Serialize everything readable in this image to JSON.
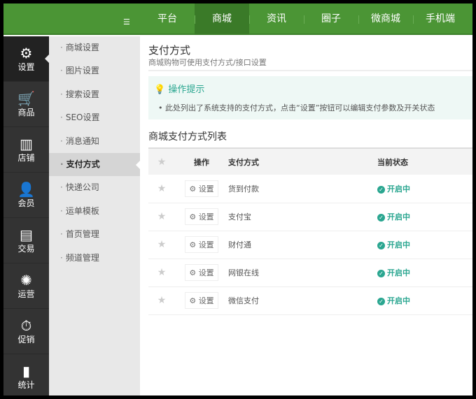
{
  "topnav": {
    "items": [
      "平台",
      "商城",
      "资讯",
      "圈子",
      "微商城",
      "手机端"
    ],
    "active": 1
  },
  "sidebar": {
    "items": [
      {
        "label": "设置",
        "icon": "gear-icon",
        "glyph": "⚙"
      },
      {
        "label": "商品",
        "icon": "basket-icon",
        "glyph": "🛒"
      },
      {
        "label": "店铺",
        "icon": "store-icon",
        "glyph": "▥"
      },
      {
        "label": "会员",
        "icon": "user-icon",
        "glyph": "👤"
      },
      {
        "label": "交易",
        "icon": "register-icon",
        "glyph": "▤"
      },
      {
        "label": "运营",
        "icon": "sale-badge-icon",
        "glyph": "✺"
      },
      {
        "label": "促销",
        "icon": "clock-icon",
        "glyph": "⏱"
      },
      {
        "label": "统计",
        "icon": "chart-icon",
        "glyph": "▮"
      }
    ]
  },
  "submenu": {
    "items": [
      "商城设置",
      "图片设置",
      "搜索设置",
      "SEO设置",
      "消息通知",
      "支付方式",
      "快递公司",
      "运单模板",
      "首页管理",
      "频道管理"
    ],
    "active": 5
  },
  "page": {
    "title": "支付方式",
    "subtitle": "商城购物可使用支付方式/接口设置"
  },
  "tips": {
    "heading": "操作提示",
    "text": "此处列出了系统支持的支付方式，点击“设置”按钮可以编辑支付参数及开关状态"
  },
  "list": {
    "title": "商城支付方式列表",
    "columns": [
      "操作",
      "支付方式",
      "当前状态"
    ],
    "button_label": "设置",
    "rows": [
      {
        "name": "货到付款",
        "status": "开启中"
      },
      {
        "name": "支付宝",
        "status": "开启中"
      },
      {
        "name": "财付通",
        "status": "开启中"
      },
      {
        "name": "网银在线",
        "status": "开启中"
      },
      {
        "name": "微信支付",
        "status": "开启中"
      }
    ]
  }
}
